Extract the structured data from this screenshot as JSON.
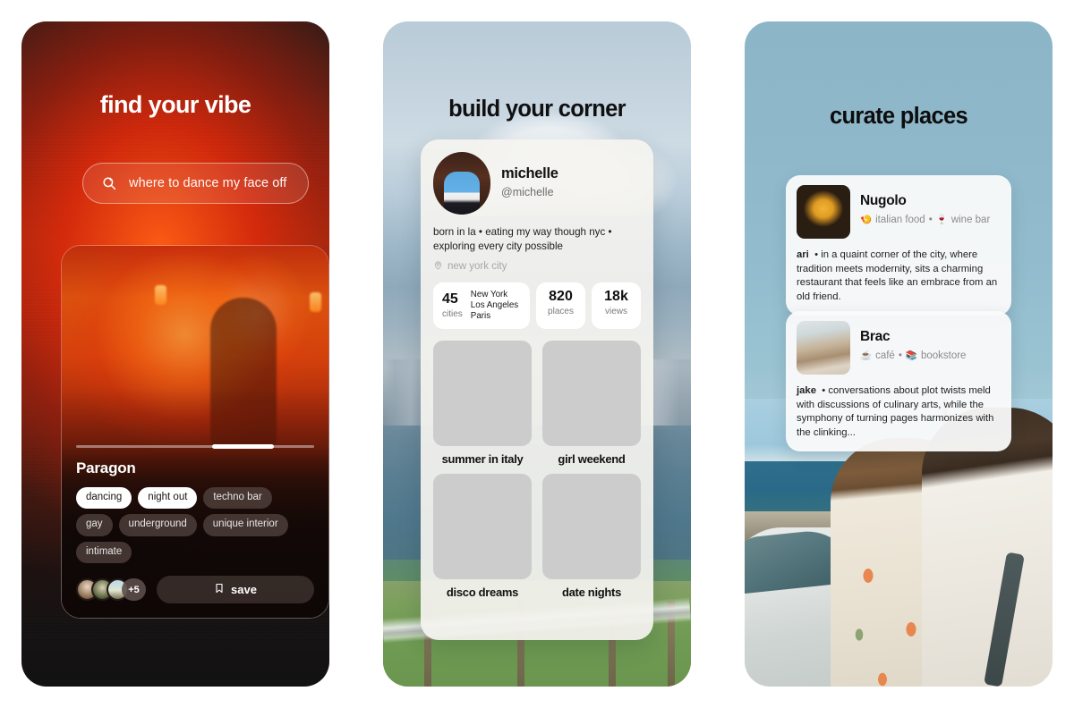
{
  "panels": [
    {
      "id": "find-your-vibe",
      "title": "find your vibe",
      "search": {
        "icon": "sparkle-search-icon",
        "value": "where to dance my face off"
      },
      "card": {
        "venue": "Paragon",
        "tags": [
          {
            "label": "dancing",
            "active": true
          },
          {
            "label": "night out",
            "active": true
          },
          {
            "label": "techno bar",
            "active": false
          },
          {
            "label": "gay",
            "active": false
          },
          {
            "label": "underground",
            "active": false
          },
          {
            "label": "unique interior",
            "active": false
          },
          {
            "label": "intimate",
            "active": false
          }
        ],
        "avatars_overflow": "+5",
        "save_label": "save",
        "save_icon": "bookmark-icon"
      }
    },
    {
      "id": "build-your-corner",
      "title": "build your corner",
      "profile": {
        "name": "michelle",
        "handle": "@michelle",
        "bio": "born in la • eating my way though nyc • exploring every city possible",
        "location": "new york city",
        "location_icon": "location-pin-icon"
      },
      "stats": [
        {
          "value": "45",
          "label": "cities",
          "detail": "New York\nLos Angeles\nParis"
        },
        {
          "value": "820",
          "label": "places"
        },
        {
          "value": "18k",
          "label": "views"
        }
      ],
      "boards": [
        {
          "caption": "summer in italy",
          "thumb": "th-italy"
        },
        {
          "caption": "girl weekend",
          "thumb": "th-flowers"
        },
        {
          "caption": "disco dreams",
          "thumb": "th-disco"
        },
        {
          "caption": "date nights",
          "thumb": "th-date"
        }
      ]
    },
    {
      "id": "curate-places",
      "title": "curate places",
      "places": [
        {
          "name": "Nugolo",
          "categories": [
            {
              "emoji": "🍤",
              "label": "italian food"
            },
            {
              "emoji": "🍷",
              "label": "wine bar"
            }
          ],
          "author": "ari",
          "description": "in a quaint corner of the city, where tradition meets modernity, sits a charming restaurant that feels like an embrace from an old friend.",
          "thumb": "th-nugolo"
        },
        {
          "name": "Brac",
          "categories": [
            {
              "emoji": "☕",
              "label": "café"
            },
            {
              "emoji": "📚",
              "label": "bookstore"
            }
          ],
          "author": "jake",
          "description": "conversations about plot twists meld with discussions of culinary arts, while the symphony of turning pages harmonizes with the clinking...",
          "thumb": "th-brac"
        }
      ]
    }
  ],
  "colors": {
    "panel1_accent": "#e04511",
    "panel2_sheet": "#f4f3ef",
    "panel3_sky": "#8cb5c8",
    "text_dark": "#101010",
    "text_muted": "#8b8b8b"
  }
}
